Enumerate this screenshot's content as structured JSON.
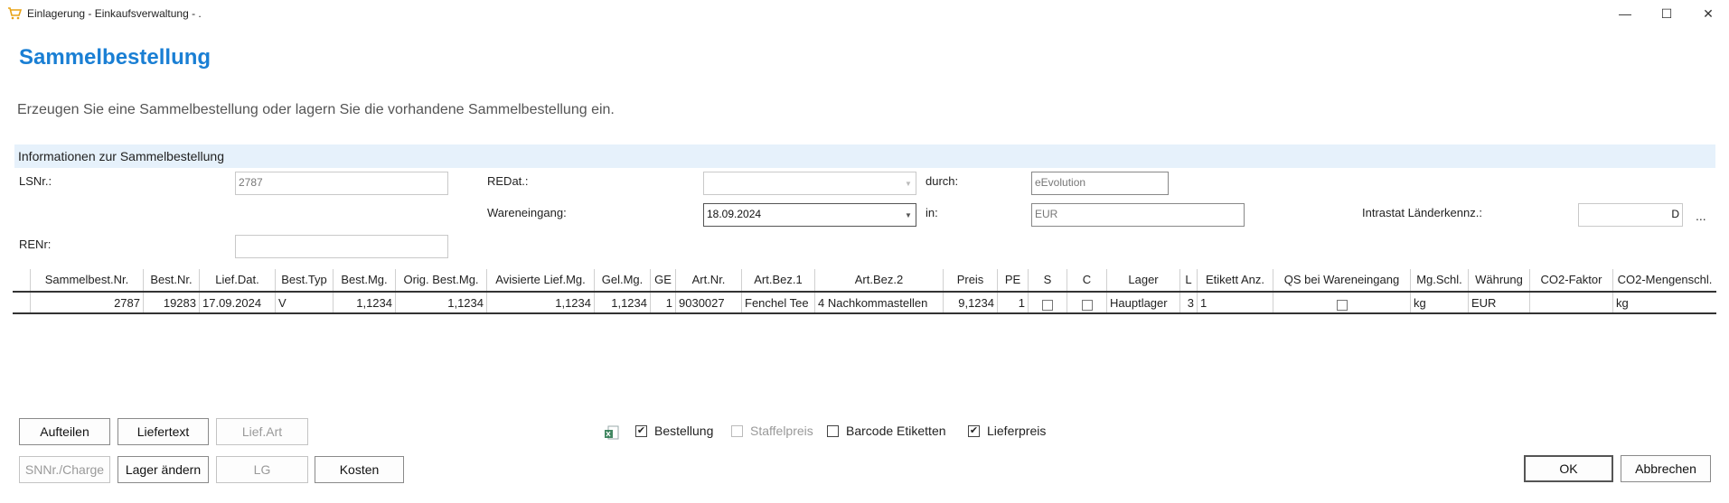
{
  "window": {
    "title": "Einlagerung - Einkaufsverwaltung -  .",
    "minimize": "—",
    "maximize": "☐",
    "close": "✕"
  },
  "page": {
    "title": "Sammelbestellung",
    "description": "Erzeugen Sie eine Sammelbestellung oder lagern Sie die vorhandene Sammelbestellung ein."
  },
  "section": {
    "title": "Informationen zur Sammelbestellung"
  },
  "form": {
    "lsnr_label": "LSNr.:",
    "lsnr_value": "2787",
    "renr_label": "RENr:",
    "renr_value": "",
    "redat_label": "REDat.:",
    "redat_value": "",
    "wareneingang_label": "Wareneingang:",
    "wareneingang_value": "18.09.2024",
    "durch_label": "durch:",
    "durch_value": "eEvolution",
    "in_label": "in:",
    "in_value": "EUR",
    "intrastat_label": "Intrastat Länderkennz.:",
    "intrastat_value": "D",
    "ellipsis": "..."
  },
  "grid": {
    "columns": [
      "Sammelbest.Nr.",
      "Best.Nr.",
      "Lief.Dat.",
      "Best.Typ",
      "Best.Mg.",
      "Orig. Best.Mg.",
      "Avisierte Lief.Mg.",
      "Gel.Mg.",
      "GE",
      "Art.Nr.",
      "Art.Bez.1",
      "Art.Bez.2",
      "Preis",
      "PE",
      "S",
      "C",
      "Lager",
      "L",
      "Etikett Anz.",
      "QS bei Wareneingang",
      "Mg.Schl.",
      "Währung",
      "CO2-Faktor",
      "CO2-Mengenschl."
    ],
    "rows": [
      {
        "sammelbest_nr": "2787",
        "best_nr": "19283",
        "lief_dat": "17.09.2024",
        "best_typ": "V",
        "best_mg": "1,1234",
        "orig_best_mg": "1,1234",
        "avisierte_lief_mg": "1,1234",
        "gel_mg": "1,1234",
        "ge": "1",
        "art_nr": "9030027",
        "art_bez1": "Fenchel Tee",
        "art_bez2": "4 Nachkommastellen",
        "preis": "9,1234",
        "pe": "1",
        "s": false,
        "c": false,
        "lager": "Hauptlager",
        "l": "3",
        "etikett_anz": "1",
        "qs": false,
        "mg_schl": "kg",
        "waehrung": "EUR",
        "co2_faktor": "",
        "co2_mengenschl": "kg"
      }
    ]
  },
  "buttons": {
    "aufteilen": "Aufteilen",
    "liefertext": "Liefertext",
    "lief_art": "Lief.Art",
    "snnr_charge": "SNNr./Charge",
    "lager_aendern": "Lager ändern",
    "lg": "LG",
    "kosten": "Kosten",
    "ok": "OK",
    "abbrechen": "Abbrechen"
  },
  "options": {
    "bestellung": {
      "label": "Bestellung",
      "checked": true
    },
    "staffelpreis": {
      "label": "Staffelpreis",
      "checked": false
    },
    "barcode_etiketten": {
      "label": "Barcode Etiketten",
      "checked": false
    },
    "lieferpreis": {
      "label": "Lieferpreis",
      "checked": true
    }
  },
  "colors": {
    "accent": "#1a7fd4",
    "section_bg": "#e6f1fb",
    "disabled_text": "#9a9a9a",
    "excel_green": "#217346"
  }
}
